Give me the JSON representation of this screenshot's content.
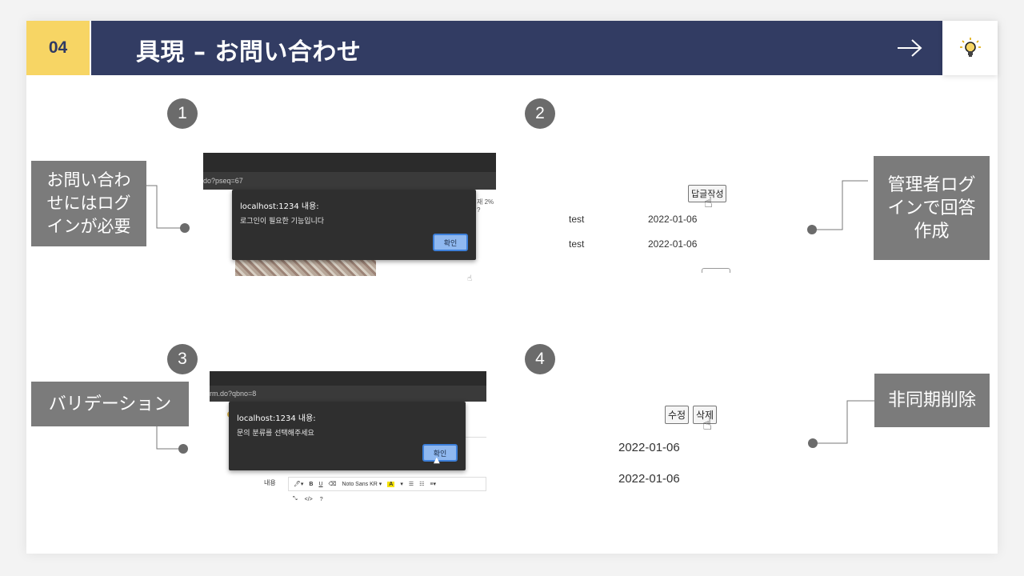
{
  "header": {
    "number": "04",
    "title": "具現 – お問い合わせ",
    "arrow_icon": "right-arrow-icon",
    "bulb_icon": "lightbulb-icon",
    "colors": {
      "accent_yellow": "#f7d564",
      "navy": "#323c63"
    }
  },
  "steps": [
    {
      "number": "1",
      "label": "お問い合わ\nせにはログ\nインが必要"
    },
    {
      "number": "2",
      "label": "管理者ログ\nインで回答\n作成"
    },
    {
      "number": "3",
      "label": "バリデーション"
    },
    {
      "number": "4",
      "label": "非同期削除"
    }
  ],
  "shot1": {
    "url": "do?pseq=67",
    "dialog_title": "localhost:1234 내용:",
    "dialog_message": "로그인이 필요한 기능입니다",
    "ok_label": "확인",
    "side_text": "재 2% ?"
  },
  "shot2": {
    "button": "답글작성",
    "rows": [
      {
        "name": "test",
        "date": "2022-01-06"
      },
      {
        "name": "test",
        "date": "2022-01-06"
      }
    ]
  },
  "shot3": {
    "url": "rm.do?qbno=8",
    "dialog_title": "localhost:1234 내용:",
    "dialog_message": "문의 분류를 선택해주세요",
    "ok_label": "확인",
    "field_label": "내용",
    "toolbar_row1": [
      "🖊▾",
      "B",
      "U",
      "⌫",
      "Noto Sans KR ▾",
      "A",
      "▾",
      "☰",
      "☷",
      "≡▾"
    ],
    "toolbar_row2": [
      "⤡",
      "</>",
      "?"
    ]
  },
  "shot4": {
    "edit_button": "수정",
    "delete_button": "삭제",
    "dates": [
      "2022-01-06",
      "2022-01-06"
    ]
  }
}
